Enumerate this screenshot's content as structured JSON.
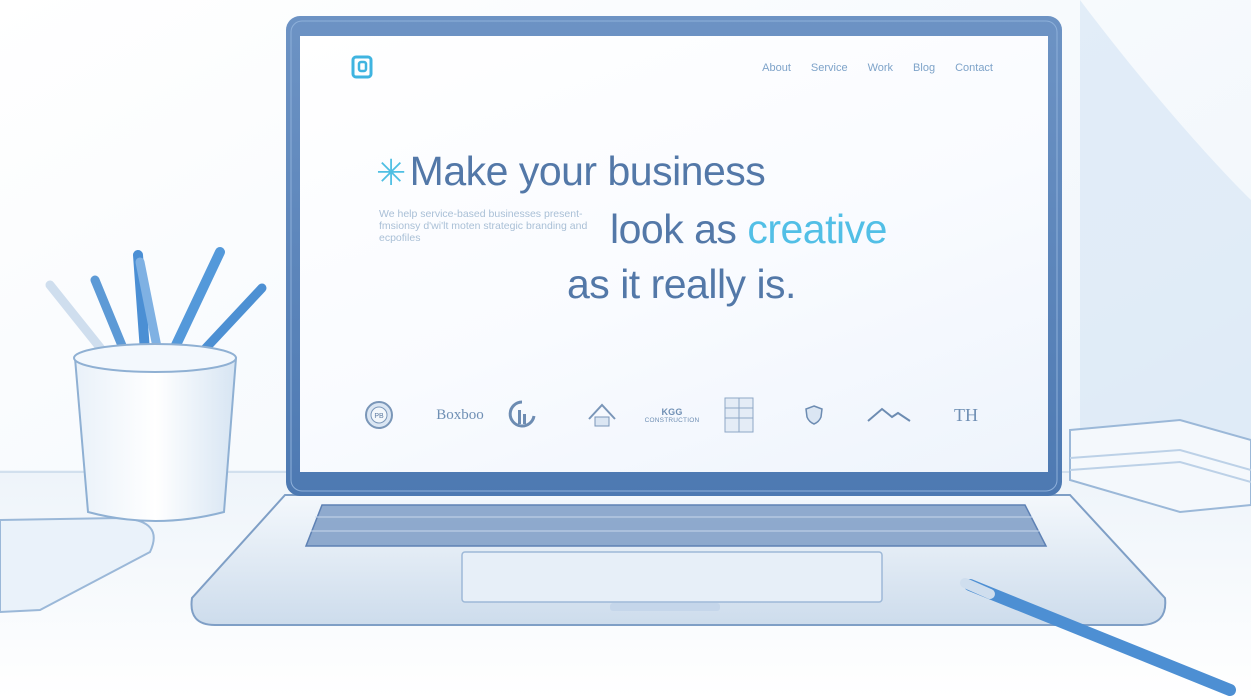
{
  "nav": {
    "items": [
      "About",
      "Service",
      "Work",
      "Blog",
      "Contact"
    ]
  },
  "hero": {
    "line1_star": "✳",
    "line1": "Make your business",
    "line2_pre": "look as ",
    "line2_accent": "creative",
    "line3": "as it really is.",
    "subtitle": "We help service-based businesses present-fmsionsy d'wi'lt moten strategic branding and ecpofiles"
  },
  "clients": {
    "pb": "PB",
    "boxboo": "Boxboo",
    "kgg_top": "KGG",
    "kgg_bottom": "CONSTRUCTION",
    "th": "TH"
  },
  "colors": {
    "accent": "#52bfe6",
    "heading": "#5378a8",
    "nav": "#7ea3c9"
  }
}
